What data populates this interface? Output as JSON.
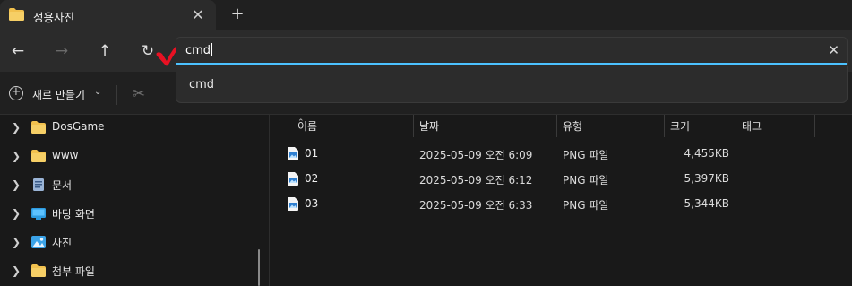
{
  "tab": {
    "title": "성용사진",
    "close": "✕",
    "add": "+"
  },
  "nav": {
    "back": "←",
    "forward": "→",
    "up": "↑",
    "refresh": "↻"
  },
  "address": {
    "value": "cmd",
    "clear": "✕"
  },
  "suggestions": [
    {
      "label": "cmd"
    }
  ],
  "toolbar": {
    "new_label": "새로 만들기",
    "new_plus": "+",
    "new_chevron": "⌄",
    "cut_glyph": "✂"
  },
  "sidebar": {
    "items": [
      {
        "label": "DosGame",
        "icon": "folder-icon",
        "chevron": "❯"
      },
      {
        "label": "www",
        "icon": "folder-icon",
        "chevron": "❯"
      },
      {
        "label": "문서",
        "icon": "documents-icon",
        "chevron": "❯"
      },
      {
        "label": "바탕 화면",
        "icon": "desktop-icon",
        "chevron": "❯"
      },
      {
        "label": "사진",
        "icon": "pictures-icon",
        "chevron": "❯"
      },
      {
        "label": "첨부 파일",
        "icon": "folder-icon",
        "chevron": "❯"
      }
    ]
  },
  "columns": {
    "name": "이름",
    "date": "날짜",
    "type": "유형",
    "size": "크기",
    "tag": "태그",
    "sort_glyph": "⌃"
  },
  "files": [
    {
      "name": "01",
      "date": "2025-05-09 오전 6:09",
      "type": "PNG 파일",
      "size": "4,455KB"
    },
    {
      "name": "02",
      "date": "2025-05-09 오전 6:12",
      "type": "PNG 파일",
      "size": "5,397KB"
    },
    {
      "name": "03",
      "date": "2025-05-09 오전 6:33",
      "type": "PNG 파일",
      "size": "5,344KB"
    }
  ],
  "colors": {
    "accent": "#4cc2ff",
    "folder": "#f2c14e",
    "check": "#e81123"
  }
}
